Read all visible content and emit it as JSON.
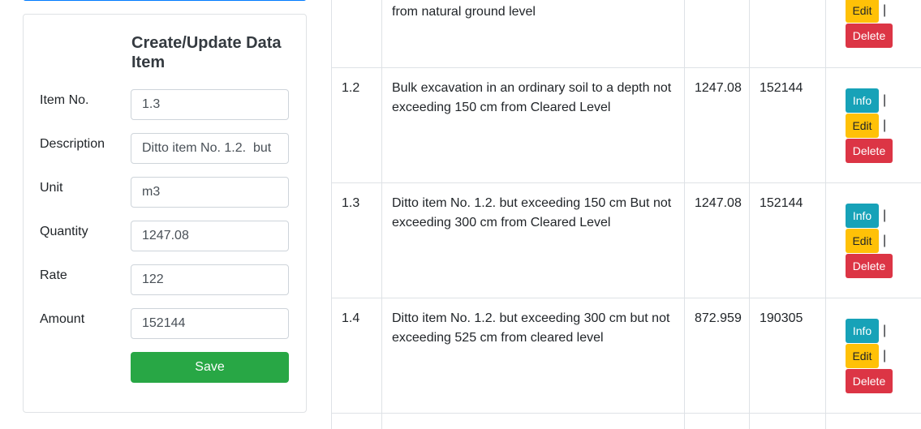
{
  "form": {
    "title": "Create/Update Data Item",
    "fields": [
      {
        "label": "Item No.",
        "value": "1.3"
      },
      {
        "label": "Description",
        "value": "Ditto item No. 1.2.  but"
      },
      {
        "label": "Unit",
        "value": "m3"
      },
      {
        "label": "Quantity",
        "value": "1247.08"
      },
      {
        "label": "Rate",
        "value": "122"
      },
      {
        "label": "Amount",
        "value": "152144"
      }
    ],
    "save_label": "Save"
  },
  "table": {
    "rows": [
      {
        "item_no": "",
        "description": "from natural ground level",
        "quantity": "",
        "amount": ""
      },
      {
        "item_no": "1.2",
        "description": "Bulk excavation in an ordinary soil to a depth not exceeding 150 cm from Cleared Level",
        "quantity": "1247.08",
        "amount": "152144"
      },
      {
        "item_no": "1.3",
        "description": "Ditto item No. 1.2. but exceeding 150 cm But not exceeding 300 cm from Cleared Level",
        "quantity": "1247.08",
        "amount": "152144"
      },
      {
        "item_no": "1.4",
        "description": "Ditto item No. 1.2. but exceeding 300 cm but not exceeding 525 cm from cleared level",
        "quantity": "872.959",
        "amount": "190305"
      }
    ],
    "actions": {
      "info": "Info",
      "edit": "Edit",
      "delete": "Delete",
      "separator": "|"
    }
  }
}
